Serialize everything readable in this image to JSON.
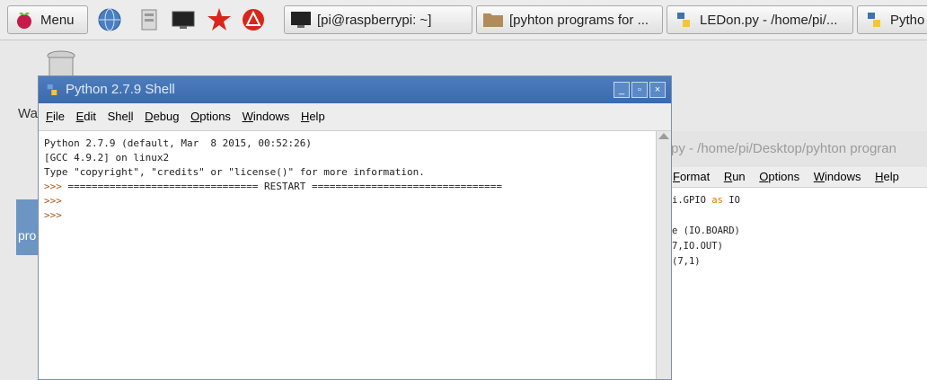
{
  "taskbar": {
    "menu_label": "Menu",
    "tasks": [
      {
        "label": "[pi@raspberrypi: ~]",
        "icon": "terminal-icon"
      },
      {
        "label": "[pyhton programs for ...",
        "icon": "folder-icon"
      },
      {
        "label": "LEDon.py - /home/pi/...",
        "icon": "python-icon"
      },
      {
        "label": "Pytho",
        "icon": "python-icon"
      }
    ],
    "launchers": [
      "globe-icon",
      "file-manager-icon",
      "terminal-icon",
      "mathematica-icon",
      "wolfram-icon"
    ]
  },
  "desktop": {
    "trash_label": "Wa",
    "selected_label": "pro"
  },
  "editor": {
    "title": "py - /home/pi/Desktop/pyhton progran",
    "menu": [
      "Format",
      "Run",
      "Options",
      "Windows",
      "Help"
    ],
    "code_lines": [
      {
        "pre": "i.GPIO ",
        "kw": "as",
        "post": " IO"
      },
      {
        "pre": "",
        "kw": "",
        "post": ""
      },
      {
        "pre": "e (IO.BOARD)",
        "kw": "",
        "post": ""
      },
      {
        "pre": "7,IO.OUT)",
        "kw": "",
        "post": ""
      },
      {
        "pre": "(7,1)",
        "kw": "",
        "post": ""
      }
    ]
  },
  "shell": {
    "title": "Python 2.7.9 Shell",
    "menu": [
      {
        "u": "F",
        "rest": "ile"
      },
      {
        "u": "E",
        "rest": "dit"
      },
      {
        "u": "",
        "rest": "Shell",
        "pre": "She",
        "uu": "l",
        "post": "l"
      },
      {
        "u": "D",
        "rest": "ebug"
      },
      {
        "u": "O",
        "rest": "ptions"
      },
      {
        "u": "W",
        "rest": "indows"
      },
      {
        "u": "H",
        "rest": "elp"
      }
    ],
    "lines": [
      "Python 2.7.9 (default, Mar  8 2015, 00:52:26)",
      "[GCC 4.9.2] on linux2",
      "Type \"copyright\", \"credits\" or \"license()\" for more information."
    ],
    "restart_line": "================================ RESTART ================================",
    "prompt": ">>>"
  }
}
